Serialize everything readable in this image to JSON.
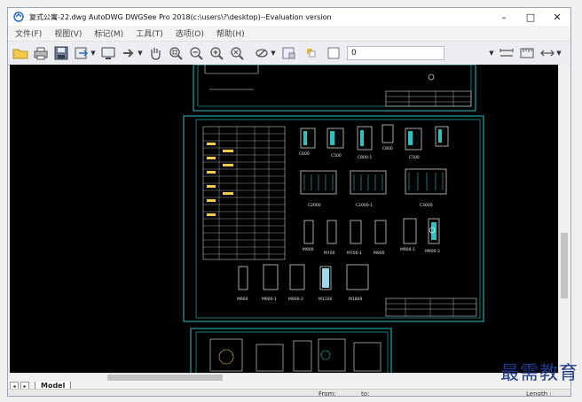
{
  "window": {
    "title": "复式公寓-22.dwg AutoDWG DWGSee Pro 2018(c:\\users\\?\\desktop)--Evaluation version",
    "minimize": "–",
    "maximize": "□",
    "close": "✕"
  },
  "menu": [
    "文件(F)",
    "视图(V)",
    "标记(M)",
    "工具(T)",
    "选项(O)",
    "帮助(H)"
  ],
  "toolbar": {
    "layer_value": "0"
  },
  "tabs": {
    "model_label": "Model"
  },
  "status": {
    "from_label": "From:",
    "to_label": "to:",
    "length_label": "Length :"
  },
  "watermark": "最需教育",
  "drawing": {
    "window_labels": [
      "C600",
      "C500",
      "C800-1",
      "C800",
      "C500",
      "C2000",
      "C2000-1",
      "C3000",
      "M900",
      "M700",
      "M700-1",
      "M900-1",
      "M900-2",
      "M900",
      "M900-1",
      "M900-2",
      "M1100",
      "M1800"
    ]
  }
}
